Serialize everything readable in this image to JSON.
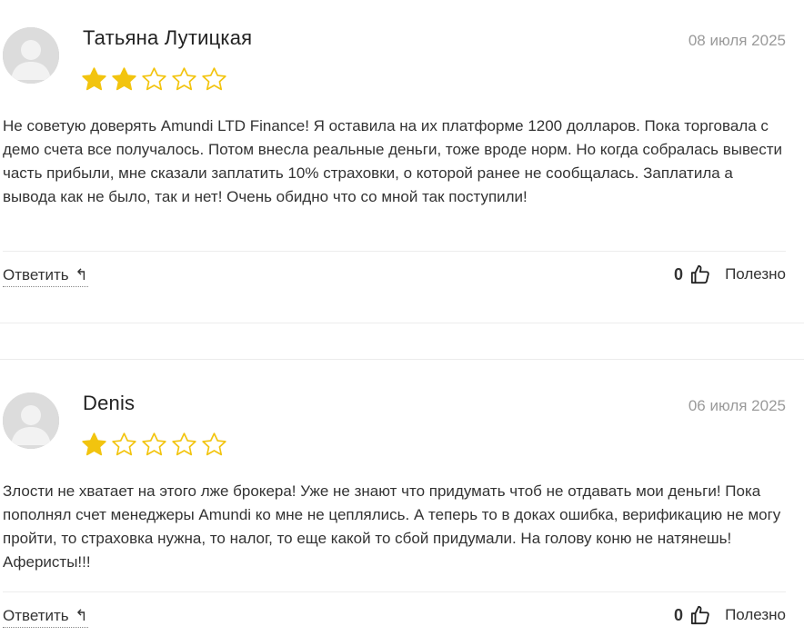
{
  "reviews": [
    {
      "author": "Татьяна Лутицкая",
      "date": "08 июля 2025",
      "rating": 2,
      "max_rating": 5,
      "text": "Не советую доверять Amundi LTD Finance! Я оставила на их платформе 1200 долларов. Пока торговала с демо счета все получалось. Потом внесла реальные деньги, тоже вроде норм. Но когда собралась вывести часть прибыли, мне сказали заплатить 10% страховки, о которой ранее не сообщалась. Заплатила а вывода как не было, так и нет! Очень обидно что со мной так поступили!",
      "reply_label": "Ответить",
      "reply_icon": "↰",
      "likes": "0",
      "helpful_label": "Полезно"
    },
    {
      "author": "Denis",
      "date": "06 июля 2025",
      "rating": 1,
      "max_rating": 5,
      "text": "Злости не хватает на этого лже брокера! Уже не знают что придумать чтоб не отдавать мои деньги! Пока пополнял счет менеджеры Amundi ко мне не цеплялись. А теперь то в доках ошибка, верификацию не могу пройти, то страховка нужна, то налог, то еще какой то сбой придумали. На голову коню не натянешь! Аферисты!!!",
      "reply_label": "Ответить",
      "reply_icon": "↰",
      "likes": "0",
      "helpful_label": "Полезно"
    }
  ],
  "colors": {
    "star_filled": "#f2c40f",
    "star_outline": "#f2c40f",
    "date": "#9a9a9a",
    "avatar_bg": "#dcdcdc"
  },
  "icons": {
    "avatar": "user-silhouette-icon",
    "star": "star-icon",
    "reply": "reply-arrow-icon",
    "like": "thumbs-up-icon"
  }
}
